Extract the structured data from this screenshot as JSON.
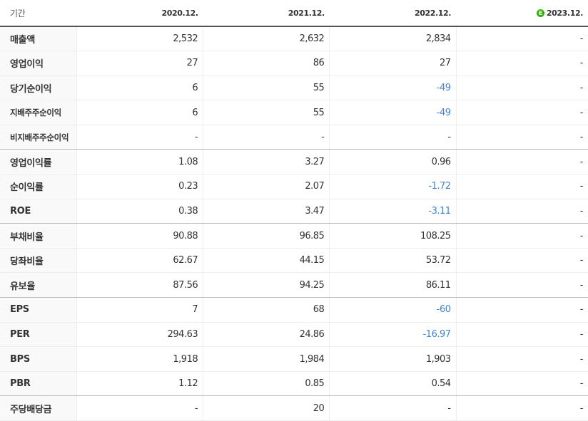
{
  "header": {
    "period_label": "기간",
    "columns": [
      "2020.12.",
      "2021.12.",
      "2022.12.",
      "2023.12."
    ],
    "estimate_badge": "E"
  },
  "rows": [
    {
      "label": "매출액",
      "values": [
        "2,532",
        "2,632",
        "2,834",
        "-"
      ]
    },
    {
      "label": "영업이익",
      "values": [
        "27",
        "86",
        "27",
        "-"
      ]
    },
    {
      "label": "당기순이익",
      "values": [
        "6",
        "55",
        "-49",
        "-"
      ]
    },
    {
      "label": "지배주주순이익",
      "values": [
        "6",
        "55",
        "-49",
        "-"
      ]
    },
    {
      "label": "비지배주주순이익",
      "values": [
        "-",
        "-",
        "-",
        "-"
      ]
    },
    {
      "label": "영업이익률",
      "values": [
        "1.08",
        "3.27",
        "0.96",
        "-"
      ]
    },
    {
      "label": "순이익률",
      "values": [
        "0.23",
        "2.07",
        "-1.72",
        "-"
      ]
    },
    {
      "label": "ROE",
      "values": [
        "0.38",
        "3.47",
        "-3.11",
        "-"
      ]
    },
    {
      "label": "부채비율",
      "values": [
        "90.88",
        "96.85",
        "108.25",
        "-"
      ]
    },
    {
      "label": "당좌비율",
      "values": [
        "62.67",
        "44.15",
        "53.72",
        "-"
      ]
    },
    {
      "label": "유보율",
      "values": [
        "87.56",
        "94.25",
        "86.11",
        "-"
      ]
    },
    {
      "label": "EPS",
      "values": [
        "7",
        "68",
        "-60",
        "-"
      ]
    },
    {
      "label": "PER",
      "values": [
        "294.63",
        "24.86",
        "-16.97",
        "-"
      ]
    },
    {
      "label": "BPS",
      "values": [
        "1,918",
        "1,984",
        "1,903",
        "-"
      ]
    },
    {
      "label": "PBR",
      "values": [
        "1.12",
        "0.85",
        "0.54",
        "-"
      ]
    },
    {
      "label": "주당배당금",
      "values": [
        "-",
        "20",
        "-",
        "-"
      ]
    }
  ],
  "colors": {
    "negative": "#3d85d8",
    "estimate_badge": "#2db400",
    "label_bg": "#f9f9f9"
  }
}
